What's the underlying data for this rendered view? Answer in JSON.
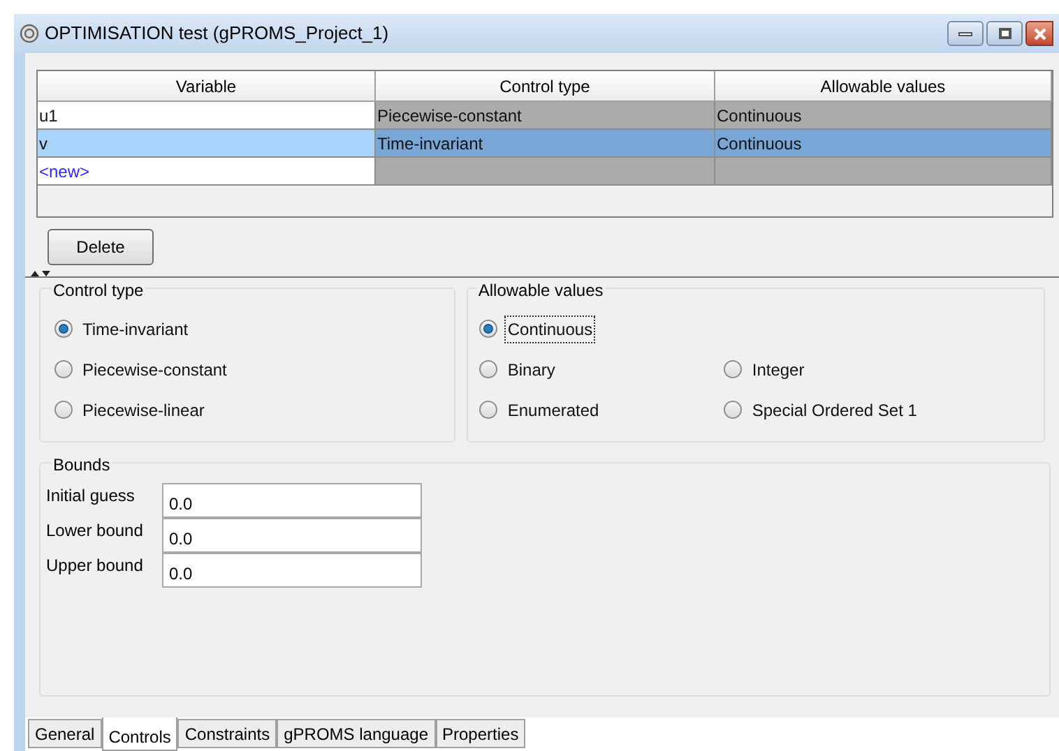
{
  "window": {
    "title": "OPTIMISATION test (gPROMS_Project_1)"
  },
  "table": {
    "columns": [
      "Variable",
      "Control type",
      "Allowable values"
    ],
    "rows": [
      {
        "kind": "entry",
        "selected": false,
        "cells": [
          "u1",
          "Piecewise-constant",
          "Continuous"
        ]
      },
      {
        "kind": "entry",
        "selected": true,
        "cells": [
          "v",
          "Time-invariant",
          "Continuous"
        ]
      },
      {
        "kind": "new",
        "selected": false,
        "cells": [
          "<new>"
        ]
      }
    ]
  },
  "delete_button": "Delete",
  "control_type": {
    "title": "Control type",
    "options": [
      {
        "label": "Time-invariant",
        "selected": true
      },
      {
        "label": "Piecewise-constant",
        "selected": false
      },
      {
        "label": "Piecewise-linear",
        "selected": false
      }
    ]
  },
  "allowable_values": {
    "title": "Allowable values",
    "options": [
      {
        "label": "Continuous",
        "selected": true
      },
      {
        "label": "Binary",
        "selected": false
      },
      {
        "label": "Integer",
        "selected": false
      },
      {
        "label": "Enumerated",
        "selected": false
      },
      {
        "label": "Special Ordered Set 1",
        "selected": false
      }
    ]
  },
  "bounds": {
    "title": "Bounds",
    "fields": [
      {
        "label": "Initial guess",
        "value": "0.0"
      },
      {
        "label": "Lower bound",
        "value": "0.0"
      },
      {
        "label": "Upper bound",
        "value": "0.0"
      }
    ]
  },
  "tabs": [
    {
      "label": "General",
      "selected": false
    },
    {
      "label": "Controls",
      "selected": true
    },
    {
      "label": "Constraints",
      "selected": false
    },
    {
      "label": "gPROMS language",
      "selected": false
    },
    {
      "label": "Properties",
      "selected": false
    }
  ]
}
